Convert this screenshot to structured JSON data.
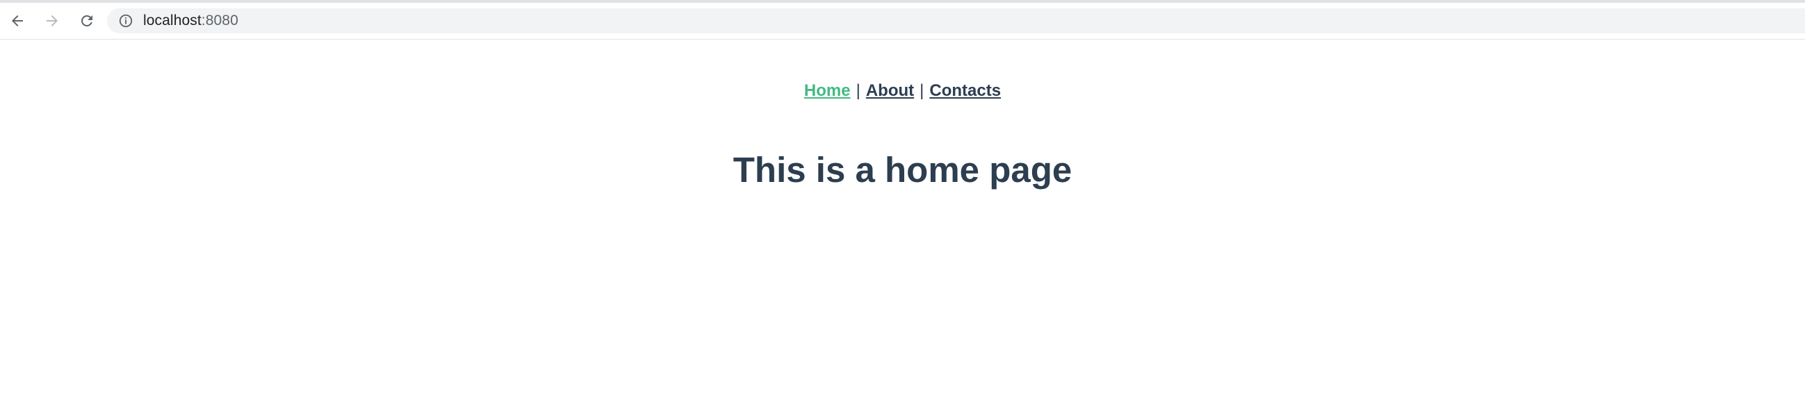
{
  "browser": {
    "url_host": "localhost",
    "url_port": ":8080",
    "icons": {
      "back": "back-arrow-icon",
      "forward": "forward-arrow-icon",
      "reload": "reload-icon",
      "info": "info-icon"
    }
  },
  "nav": {
    "links": [
      {
        "label": "Home",
        "active": true
      },
      {
        "label": "About",
        "active": false
      },
      {
        "label": "Contacts",
        "active": false
      }
    ],
    "separator": "|"
  },
  "main": {
    "heading": "This is a home page"
  },
  "colors": {
    "text": "#2c3e50",
    "active_link": "#42b983"
  }
}
